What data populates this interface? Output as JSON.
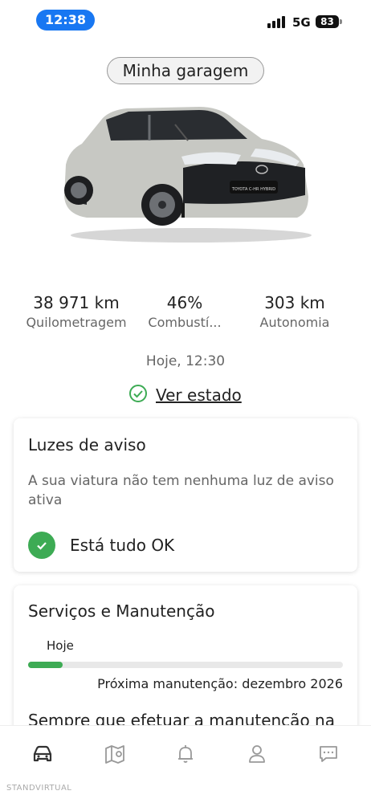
{
  "status_bar": {
    "time": "12:38",
    "network": "5G",
    "battery": "83"
  },
  "header": {
    "garage_button": "Minha garagem"
  },
  "stats": [
    {
      "value": "38 971 km",
      "label": "Quilometragem"
    },
    {
      "value": "46%",
      "label": "Combustí..."
    },
    {
      "value": "303 km",
      "label": "Autonomia"
    }
  ],
  "updated": "Hoje, 12:30",
  "status_link": "Ver estado",
  "warning_card": {
    "title": "Luzes de aviso",
    "text": "A sua viatura não tem nenhuma luz de aviso ativa",
    "ok_label": "Está tudo OK"
  },
  "service_card": {
    "title": "Serviços e Manutenção",
    "progress_label": "Hoje",
    "progress_fraction": 0.11,
    "next": "Próxima manutenção: dezembro 2026",
    "body": "Sempre que efetuar a manutenção na"
  },
  "tabs": [
    {
      "icon": "car-icon",
      "active": true
    },
    {
      "icon": "map-icon",
      "active": false
    },
    {
      "icon": "bell-icon",
      "active": false
    },
    {
      "icon": "profile-icon",
      "active": false
    },
    {
      "icon": "chat-icon",
      "active": false
    }
  ],
  "watermark": "STANDVIRTUAL",
  "colors": {
    "accent_blue": "#1877f2",
    "ok_green": "#3dab54",
    "active_tab": "#333333",
    "inactive_tab": "#999999"
  }
}
